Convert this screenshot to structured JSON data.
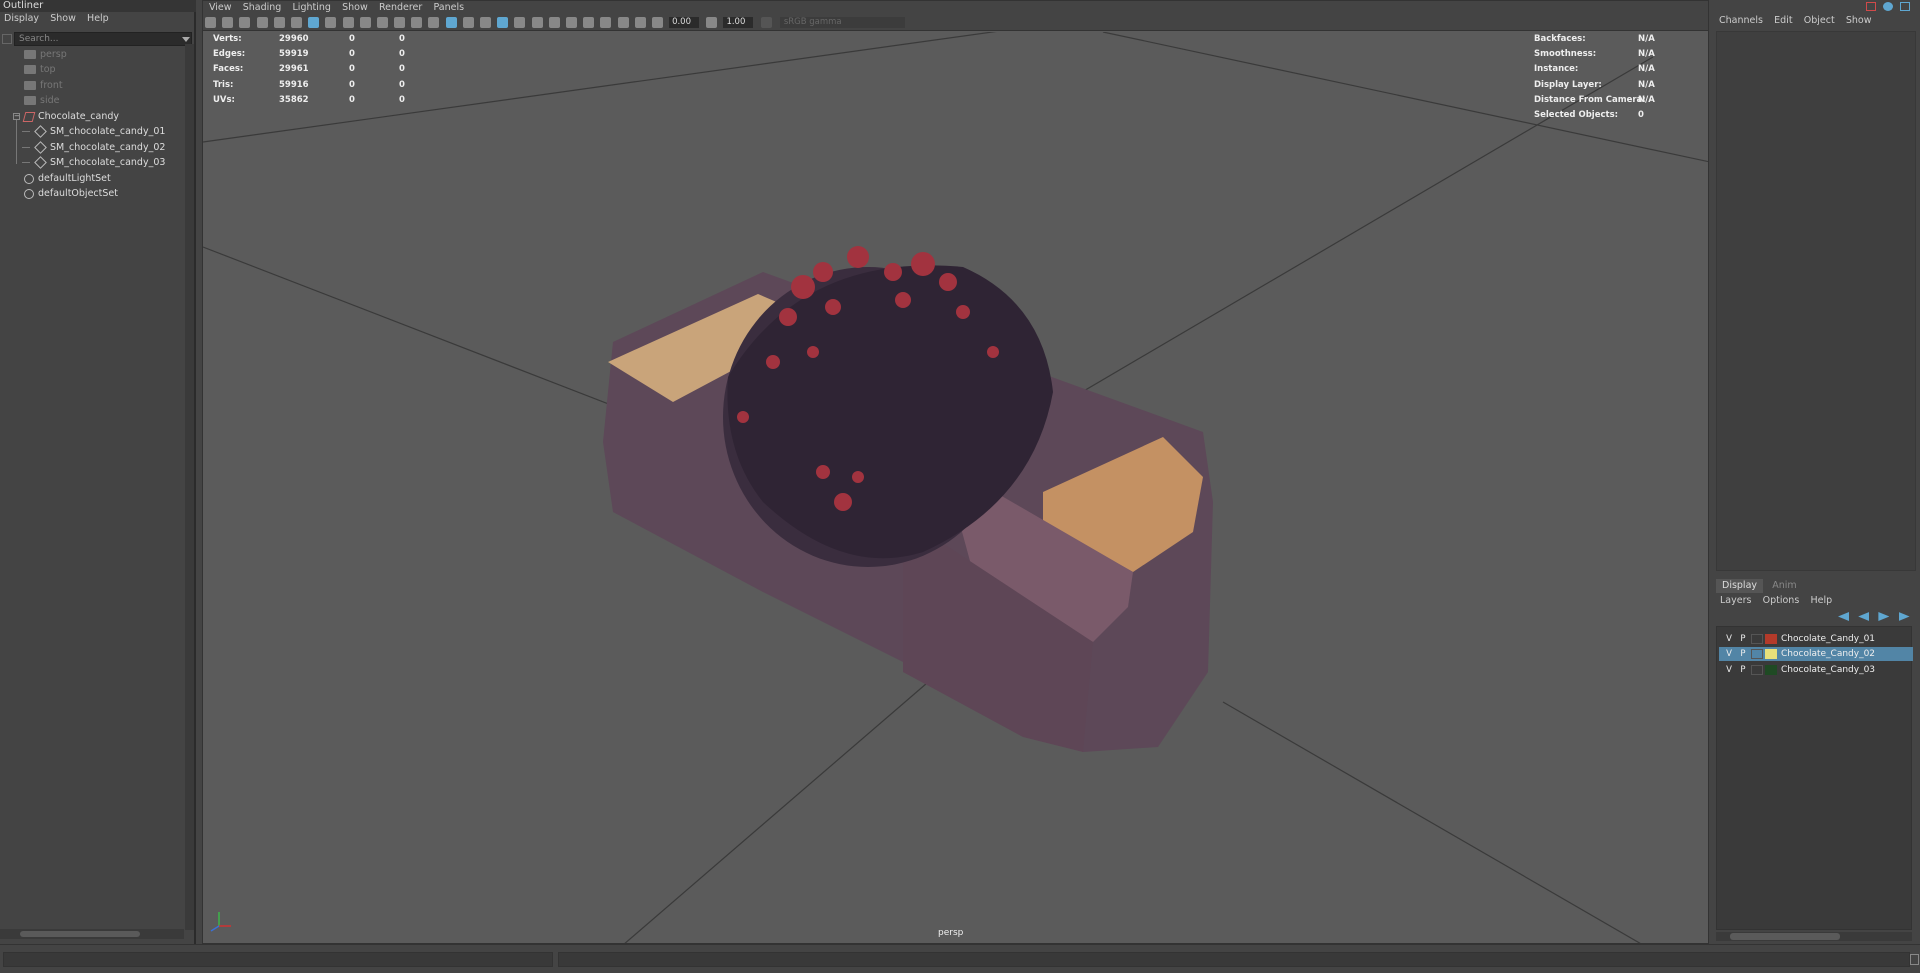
{
  "outliner": {
    "title": "Outliner",
    "menu": [
      "Display",
      "Show",
      "Help"
    ],
    "search_placeholder": "Search...",
    "items": [
      {
        "label": "persp",
        "dim": true
      },
      {
        "label": "top",
        "dim": true
      },
      {
        "label": "front",
        "dim": true
      },
      {
        "label": "side",
        "dim": true
      },
      {
        "label": "Chocolate_candy",
        "dim": false
      },
      {
        "label": "SM_chocolate_candy_01",
        "dim": false
      },
      {
        "label": "SM_chocolate_candy_02",
        "dim": false
      },
      {
        "label": "SM_chocolate_candy_03",
        "dim": false
      },
      {
        "label": "defaultLightSet",
        "dim": false
      },
      {
        "label": "defaultObjectSet",
        "dim": false
      }
    ]
  },
  "viewport": {
    "menu": [
      "View",
      "Shading",
      "Lighting",
      "Show",
      "Renderer",
      "Panels"
    ],
    "exposure": "0.00",
    "gamma": "1.00",
    "color_space": "sRGB gamma",
    "camera_label": "persp",
    "stats": [
      {
        "label": "Verts:",
        "v1": "29960",
        "v2": "0",
        "v3": "0"
      },
      {
        "label": "Edges:",
        "v1": "59919",
        "v2": "0",
        "v3": "0"
      },
      {
        "label": "Faces:",
        "v1": "29961",
        "v2": "0",
        "v3": "0"
      },
      {
        "label": "Tris:",
        "v1": "59916",
        "v2": "0",
        "v3": "0"
      },
      {
        "label": "UVs:",
        "v1": "35862",
        "v2": "0",
        "v3": "0"
      }
    ],
    "info": [
      {
        "label": "Backfaces:",
        "value": "N/A"
      },
      {
        "label": "Smoothness:",
        "value": "N/A"
      },
      {
        "label": "Instance:",
        "value": "N/A"
      },
      {
        "label": "Display Layer:",
        "value": "N/A"
      },
      {
        "label": "Distance From Camera:",
        "value": "N/A"
      },
      {
        "label": "Selected Objects:",
        "value": "0"
      }
    ]
  },
  "channel_box": {
    "menu": [
      "Channels",
      "Edit",
      "Object",
      "Show"
    ]
  },
  "layer_editor": {
    "tabs": [
      "Display",
      "Anim"
    ],
    "menu": [
      "Layers",
      "Options",
      "Help"
    ],
    "layers": [
      {
        "v": "V",
        "p": "P",
        "name": "Chocolate_Candy_01",
        "color": "#b33a2a",
        "selected": false
      },
      {
        "v": "V",
        "p": "P",
        "name": "Chocolate_Candy_02",
        "color": "#e8e07a",
        "selected": true
      },
      {
        "v": "V",
        "p": "P",
        "name": "Chocolate_Candy_03",
        "color": "#1f4a24",
        "selected": false
      }
    ]
  },
  "colors": {
    "accent": "#5fa7d1",
    "selection": "#5285a6",
    "viewport_bg": "#5b5b5b"
  }
}
